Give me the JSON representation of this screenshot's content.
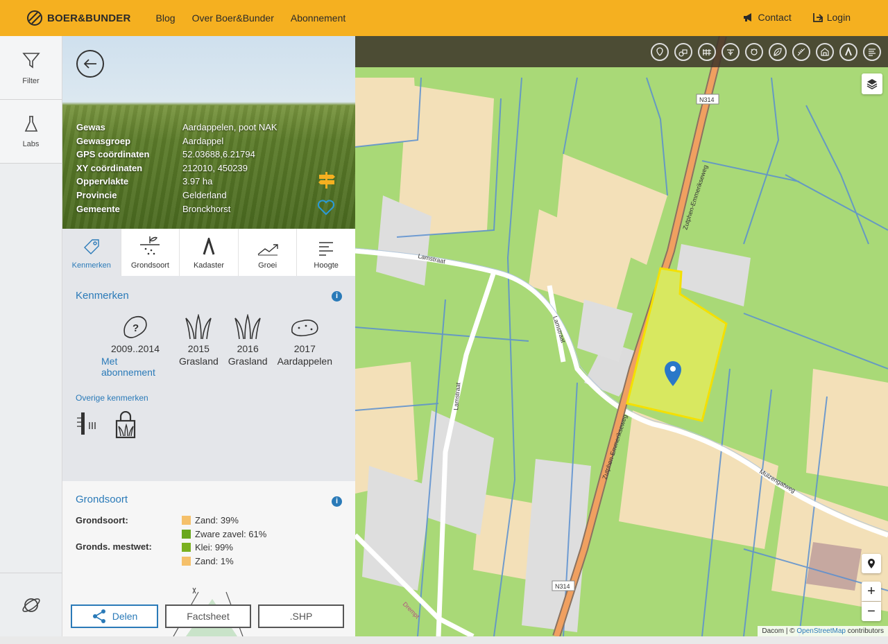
{
  "header": {
    "logo_text": "BOER&BUNDER",
    "nav": [
      "Blog",
      "Over Boer&Bunder",
      "Abonnement"
    ],
    "contact_label": "Contact",
    "login_label": "Login"
  },
  "rail": {
    "filter_label": "Filter",
    "labs_label": "Labs"
  },
  "parcel": {
    "rows": [
      {
        "k": "Gewas",
        "v": "Aardappelen, poot NAK"
      },
      {
        "k": "Gewasgroep",
        "v": "Aardappel"
      },
      {
        "k": "GPS coördinaten",
        "v": "52.03688,6.21794"
      },
      {
        "k": "XY coördinaten",
        "v": "212010, 450239"
      },
      {
        "k": "Oppervlakte",
        "v": "3.97 ha"
      },
      {
        "k": "Provincie",
        "v": "Gelderland"
      },
      {
        "k": "Gemeente",
        "v": "Bronckhorst"
      }
    ]
  },
  "tabs": [
    "Kenmerken",
    "Grondsoort",
    "Kadaster",
    "Groei",
    "Hoogte"
  ],
  "kenmerken": {
    "title": "Kenmerken",
    "years": [
      {
        "year": "2009..2014",
        "label": "Met abonnement",
        "icon": "potato-question-icon"
      },
      {
        "year": "2015",
        "label": "Grasland",
        "icon": "grass-icon"
      },
      {
        "year": "2016",
        "label": "Grasland",
        "icon": "grass-icon"
      },
      {
        "year": "2017",
        "label": "Aardappelen",
        "icon": "potato-icon"
      }
    ],
    "overig_title": "Overige kenmerken"
  },
  "grondsoort": {
    "title": "Grondsoort",
    "label1": "Grondsoort:",
    "label2": "Gronds. mestwet:",
    "values": [
      {
        "text": "Zand: 39%",
        "color": "#f5c06a"
      },
      {
        "text": "Zware zavel: 61%",
        "color": "#6aa81e"
      },
      {
        "text": "Klei: 99%",
        "color": "#7ab020"
      },
      {
        "text": "Zand: 1%",
        "color": "#f5c06a"
      }
    ]
  },
  "buttons": {
    "share": "Delen",
    "factsheet": "Factsheet",
    "shp": ".SHP"
  },
  "map": {
    "roads": [
      "N314",
      "N314",
      "Zutphen-Emmerikseweg",
      "Zutphen-Emmerikseweg",
      "Lamstraat",
      "Lamstraat",
      "Lamstraat",
      "Muizengatweg",
      "Drempt"
    ],
    "zoom_in": "+",
    "zoom_out": "−",
    "attribution_prefix": "Dacom | ©",
    "attribution_link": "OpenStreetMap",
    "attribution_suffix": "contributors"
  },
  "colors": {
    "accent": "#f5b020",
    "link": "#2a7ab8",
    "parcel": "#f0e020"
  }
}
